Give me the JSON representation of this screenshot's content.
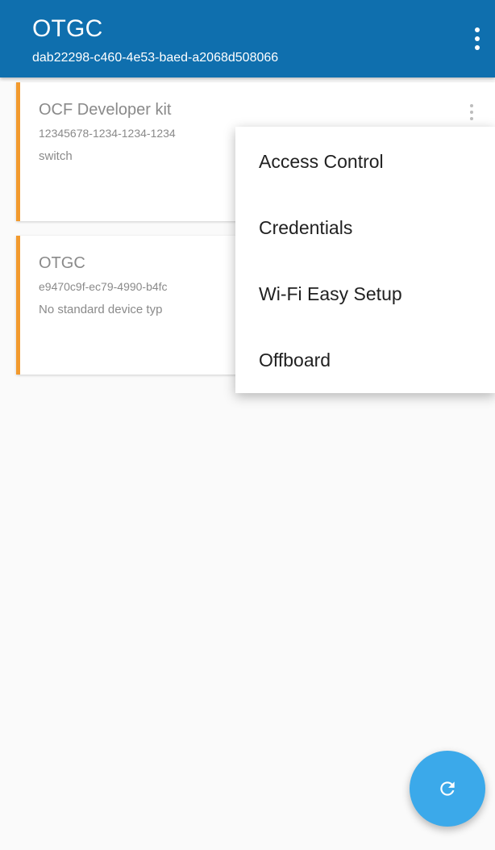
{
  "appbar": {
    "title": "OTGC",
    "subtitle": "dab22298-c460-4e53-baed-a2068d508066",
    "color": "#0f6fae"
  },
  "devices": [
    {
      "name": "OCF Developer kit",
      "uuid": "12345678-1234-1234-1234",
      "type": "switch",
      "accent": "#f29a2e"
    },
    {
      "name": "OTGC",
      "uuid": "e9470c9f-ec79-4990-b4fc",
      "type": "No standard device typ",
      "accent": "#f29a2e"
    }
  ],
  "popup_menu": {
    "items": [
      {
        "label": "Access Control"
      },
      {
        "label": "Credentials"
      },
      {
        "label": "Wi-Fi Easy Setup"
      },
      {
        "label": "Offboard"
      }
    ]
  },
  "fab": {
    "icon": "refresh-icon",
    "color": "#3ba9ea"
  }
}
